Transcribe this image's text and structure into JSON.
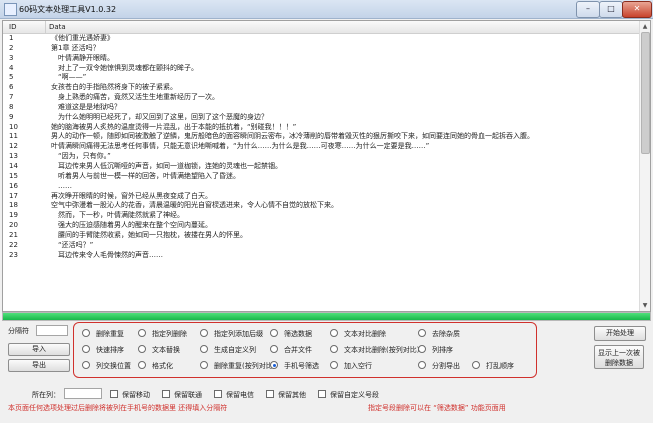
{
  "window": {
    "title": "60码文本处理工具V1.0.32",
    "min_label": "–",
    "max_label": "□",
    "close_label": "✕"
  },
  "grid": {
    "col_id": "ID",
    "col_data": "Data",
    "rows": [
      {
        "id": "1",
        "text": "《他们重光遇娇妻》"
      },
      {
        "id": "2",
        "text": "第1章 还活吗？"
      },
      {
        "id": "3",
        "text": "　叶倩满静开眼睛。"
      },
      {
        "id": "4",
        "text": "　对上了一双令她惊惧到灵魂都在颤抖的眸子。"
      },
      {
        "id": "5",
        "text": "　“啊——”"
      },
      {
        "id": "6",
        "text": "女孩苍白的手指陷然将身下的被子紧紧。"
      },
      {
        "id": "7",
        "text": "　身上熟悉的痛苦，竟然又活生生地重新经历了一次。"
      },
      {
        "id": "8",
        "text": "　难道这是是地狱吗？"
      },
      {
        "id": "9",
        "text": "　为什么她明明已经死了，却又回到了这里，回到了这个恶魔的身边？"
      },
      {
        "id": "10",
        "text": "她的脑海被男人炙热的温度烫得一片混乱，出于本能的抵抗着，“别碰我！！！”"
      },
      {
        "id": "11",
        "text": "男人的动作一顿，随即如同被激触了逆鳞，鬼厉般暗色的面容瞬间阴云密布，冰冷薄削的唇带着毁灭性的狠厉撕咬下来，如同要连同她的骨血一起拆吞入腹。"
      },
      {
        "id": "12",
        "text": "叶倩满瞬间痛得无法思考任何事情，只能无意识地嘶喊着，“为什么……为什么是我……可夜寒……为什么一定要是我……”"
      },
      {
        "id": "13",
        "text": "　“因为，只有你。”"
      },
      {
        "id": "14",
        "text": "　耳边传来男人低沉嘶哑的声音，如同一道枷锁，连她的灵魂也一起禁锢。"
      },
      {
        "id": "15",
        "text": "　听着男人与前世一模一样的回答，叶倩满绝望陷入了昏迷。"
      },
      {
        "id": "16",
        "text": "　……"
      },
      {
        "id": "17",
        "text": "再次睁开眼睛的时候，窗外已经从黑夜变成了白天。"
      },
      {
        "id": "18",
        "text": "空气中弥漫着一股沁人的花香，清晨温暖的阳光自窗棂透进来，令人心情不自觉的放松下来。"
      },
      {
        "id": "19",
        "text": "　然而，下一秒，叶倩满陡然就紧了神经。"
      },
      {
        "id": "20",
        "text": "　强大的压迫感随着男人的醒来在整个空间内蔓延。"
      },
      {
        "id": "21",
        "text": "　腰间的手臂陡然收紧，她如同一只抱枕，被搂在男人的怀里。"
      },
      {
        "id": "22",
        "text": "　“还活吗？”"
      },
      {
        "id": "23",
        "text": "　耳边传来令人毛骨悚然的声音……"
      }
    ]
  },
  "progress": {
    "value": 100
  },
  "left": {
    "separator_label": "分隔符",
    "import_label": "导入",
    "export_label": "导出"
  },
  "options": [
    {
      "label": "删除重复",
      "selected": false
    },
    {
      "label": "指定列删除",
      "selected": false
    },
    {
      "label": "指定列添加后缀",
      "selected": false
    },
    {
      "label": "筛选数据",
      "selected": false
    },
    {
      "label": "文本对比删除",
      "selected": false
    },
    {
      "label": "去除杂质",
      "selected": false
    },
    {
      "label": "快速排序",
      "selected": false
    },
    {
      "label": "文本替换",
      "selected": false
    },
    {
      "label": "生成自定义列",
      "selected": false
    },
    {
      "label": "合并文件",
      "selected": false
    },
    {
      "label": "文本对比删除(按列对比)",
      "selected": false
    },
    {
      "label": "列排序",
      "selected": false
    },
    {
      "label": "列交换位置",
      "selected": false
    },
    {
      "label": "格式化",
      "selected": false
    },
    {
      "label": "删除重复(按列对比)",
      "selected": false
    },
    {
      "label": "手机号筛选",
      "selected": true
    },
    {
      "label": "加入空行",
      "selected": false
    },
    {
      "label": "分割导出",
      "selected": false
    },
    {
      "label": "打乱顺序",
      "selected": false
    }
  ],
  "right": {
    "start_label": "开始处理",
    "show_delete_line1": "显示上一次被",
    "show_delete_line2": "删除数据"
  },
  "bottom": {
    "column_label": "所在列：",
    "checks": [
      {
        "label": "保留移动"
      },
      {
        "label": "保留联通"
      },
      {
        "label": "保留电信"
      },
      {
        "label": "保留其他"
      },
      {
        "label": "保留自定义号段"
      }
    ],
    "status_left": "本页面任何选项处理过后删除将被列在手机号的数据里 还得填入分隔符",
    "status_right": "指定号段删除可以在 “筛选数据” 功能页面用"
  },
  "colors": {
    "highlight_border": "#d0312d",
    "progress_fill": "#19b84a",
    "status_text": "#d0312d"
  }
}
